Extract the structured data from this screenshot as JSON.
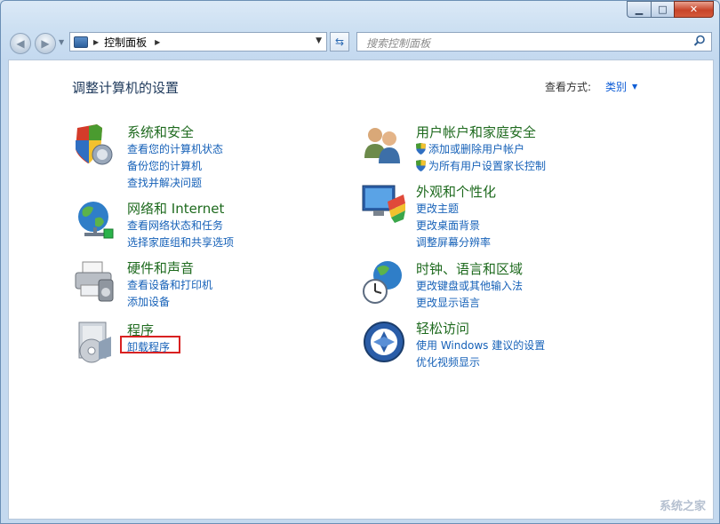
{
  "window": {
    "caption": {
      "minimize": "▁",
      "maximize": "□",
      "close": "✕"
    }
  },
  "nav": {
    "back_icon": "arrow-left-icon",
    "forward_icon": "arrow-right-icon",
    "address": {
      "breadcrumb": "控制面板"
    },
    "search_placeholder": "搜索控制面板"
  },
  "page": {
    "title": "调整计算机的设置",
    "view_by_label": "查看方式:",
    "view_by_value": "类别"
  },
  "categories": [
    {
      "title": "系统和安全",
      "links": [
        "查看您的计算机状态",
        "备份您的计算机",
        "查找并解决问题"
      ]
    },
    {
      "title": "网络和 Internet",
      "links": [
        "查看网络状态和任务",
        "选择家庭组和共享选项"
      ]
    },
    {
      "title": "硬件和声音",
      "links": [
        "查看设备和打印机",
        "添加设备"
      ]
    },
    {
      "title": "程序",
      "links": [
        "卸载程序"
      ]
    },
    {
      "title": "用户帐户和家庭安全",
      "links": [
        "添加或删除用户帐户",
        "为所有用户设置家长控制"
      ]
    },
    {
      "title": "外观和个性化",
      "links": [
        "更改主题",
        "更改桌面背景",
        "调整屏幕分辨率"
      ]
    },
    {
      "title": "时钟、语言和区域",
      "links": [
        "更改键盘或其他输入法",
        "更改显示语言"
      ]
    },
    {
      "title": "轻松访问",
      "links": [
        "使用 Windows 建议的设置",
        "优化视频显示"
      ]
    }
  ],
  "watermark": "系统之家",
  "colors": {
    "heading": "#1e6a1e",
    "link": "#1661b8",
    "highlight": "#d92121"
  }
}
